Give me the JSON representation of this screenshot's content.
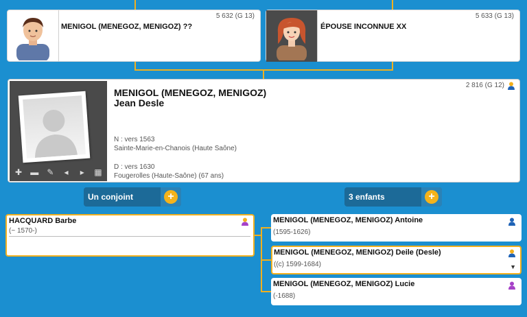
{
  "father": {
    "name": "MENIGOL (MENEGOZ, MENIGOZ) ??",
    "sosa": "5 632 (G 13)"
  },
  "mother": {
    "name": "ÉPOUSE INCONNUE XX",
    "sosa": "5 633 (G 13)"
  },
  "main": {
    "surname": "MENIGOL (MENEGOZ, MENIGOZ)",
    "given": "Jean Desle",
    "sosa": "2 816 (G 12)",
    "birth_label": "N : vers 1563",
    "birth_place": "Sainte-Marie-en-Chanois (Haute Saône)",
    "death_label": "D : vers 1630",
    "death_place": "Fougerolles (Haute-Saône) (67 ans)",
    "toolbar_icons": [
      "plus-icon",
      "minus-icon",
      "pencil-icon",
      "arrow-left-icon",
      "arrow-right-icon",
      "film-icon"
    ]
  },
  "spouse_section": {
    "label": "Un conjoint",
    "plus": "+"
  },
  "children_section": {
    "label": "3 enfants",
    "plus": "+"
  },
  "spouse": {
    "name": "HACQUARD Barbe",
    "dates": "(~ 1570-)",
    "gender_color": "#a642c8"
  },
  "children": [
    {
      "name": "MENIGOL (MENEGOZ, MENIGOZ) Antoine",
      "dates": "(1595-1626)",
      "gender_color": "#1f63b6"
    },
    {
      "name": "MENIGOL (MENEGOZ, MENIGOZ) Deile (Desle)",
      "dates": "((c) 1599-1684)",
      "gender_color": "#1f63b6"
    },
    {
      "name": "MENIGOL (MENEGOZ, MENIGOZ) Lucie",
      "dates": "(-1688)",
      "gender_color": "#a642c8"
    }
  ],
  "colors": {
    "background": "#1b8fd0",
    "accent_gold": "#f2b01e",
    "pill_dark": "#1c6a98"
  }
}
